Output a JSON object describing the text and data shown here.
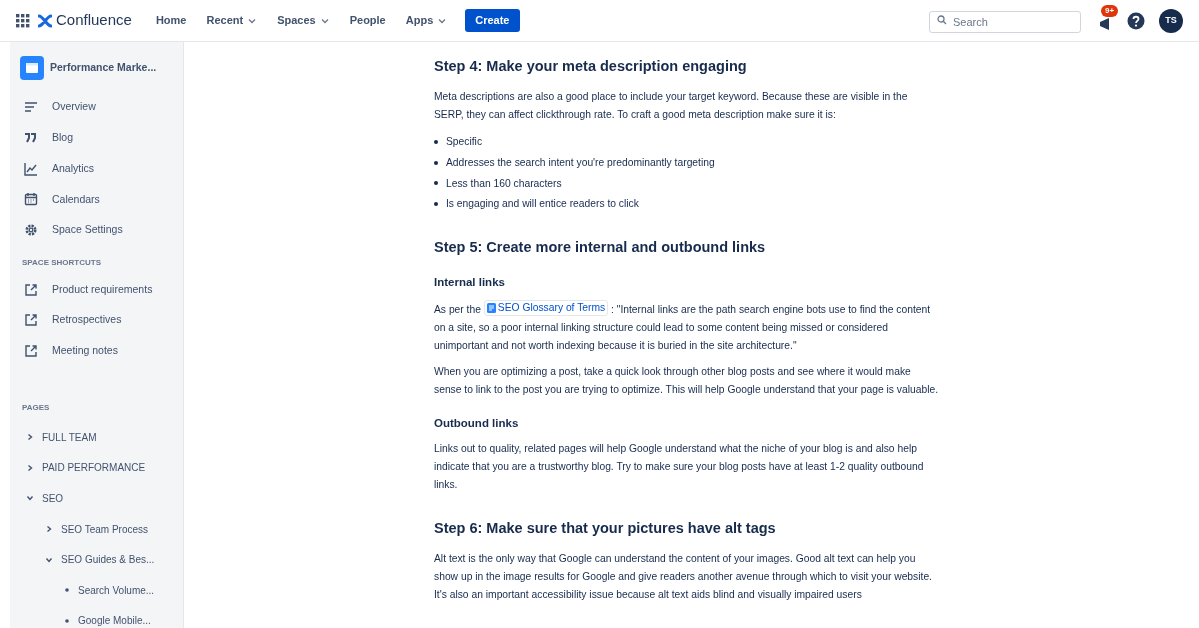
{
  "nav": {
    "app_name": "Confluence",
    "links": [
      {
        "label": "Home",
        "dropdown": false
      },
      {
        "label": "Recent",
        "dropdown": true
      },
      {
        "label": "Spaces",
        "dropdown": true
      },
      {
        "label": "People",
        "dropdown": false
      },
      {
        "label": "Apps",
        "dropdown": true
      }
    ],
    "create_button": "Create",
    "search": {
      "placeholder": "Search"
    },
    "notification_badge": "9+",
    "avatar": "TS"
  },
  "sidebar": {
    "space_title": "Performance Marke...",
    "items": [
      {
        "label": "Overview"
      },
      {
        "label": "Blog"
      },
      {
        "label": "Analytics"
      },
      {
        "label": "Calendars"
      },
      {
        "label": "Space Settings"
      }
    ],
    "shortcuts_heading": "SPACE SHORTCUTS",
    "shortcuts": [
      {
        "label": "Product requirements"
      },
      {
        "label": "Retrospectives"
      },
      {
        "label": "Meeting notes"
      }
    ],
    "pages_heading": "PAGES",
    "pages": [
      {
        "label": "FULL TEAM",
        "expanded": false
      },
      {
        "label": "PAID PERFORMANCE",
        "expanded": false
      },
      {
        "label": "SEO",
        "expanded": true,
        "children": [
          {
            "label": "SEO Team Process",
            "expanded": false
          },
          {
            "label": "SEO Guides & Bes...",
            "expanded": true,
            "children": [
              {
                "label": "Search Volume..."
              },
              {
                "label": "Google Mobile..."
              }
            ]
          }
        ]
      }
    ]
  },
  "content": [
    {
      "kind": "heading",
      "text": "Step 4: Make your meta description engaging"
    },
    {
      "kind": "paragraph",
      "text": "Meta descriptions are also a good place to include your target keyword. Because these are visible in the SERP, they can affect clickthrough rate. To craft a good meta description make sure it is:"
    },
    {
      "kind": "bullets",
      "items": [
        "Specific",
        "Addresses the search intent you're predominantly targeting",
        "Less than 160 characters",
        "Is engaging and will entice readers to click"
      ]
    },
    {
      "kind": "heading",
      "text": "Step 5: Create more internal and outbound links"
    },
    {
      "kind": "subheading",
      "text": "Internal links"
    },
    {
      "kind": "link_paragraph",
      "before": "As per the",
      "link": "SEO Glossary of Terms",
      "after": ":  \"Internal links are the path search engine bots use to find the content on a site, so a poor internal linking structure could lead to some content being missed or considered unimportant and not worth indexing because it is buried in the site architecture.\""
    },
    {
      "kind": "paragraph",
      "text": "When you are optimizing a post, take a quick look through other blog posts and see where it would make sense to link to the post you are trying to optimize. This will help Google understand that your page is valuable."
    },
    {
      "kind": "subheading",
      "text": "Outbound links"
    },
    {
      "kind": "paragraph",
      "text": "Links out to quality, related pages will help Google understand what the niche of your blog is and also help indicate that you are a trustworthy blog. Try to make sure your blog posts have at least 1-2 quality outbound links."
    },
    {
      "kind": "heading",
      "text": "Step 6: Make sure that your pictures have alt tags"
    },
    {
      "kind": "paragraph",
      "text": "Alt text is the only way that Google can understand the content of your images. Good alt text can help you show up in the image results for Google and give readers another avenue through which to visit your website.  It's also an important accessibility issue because alt text aids blind and visually impaired users"
    }
  ]
}
